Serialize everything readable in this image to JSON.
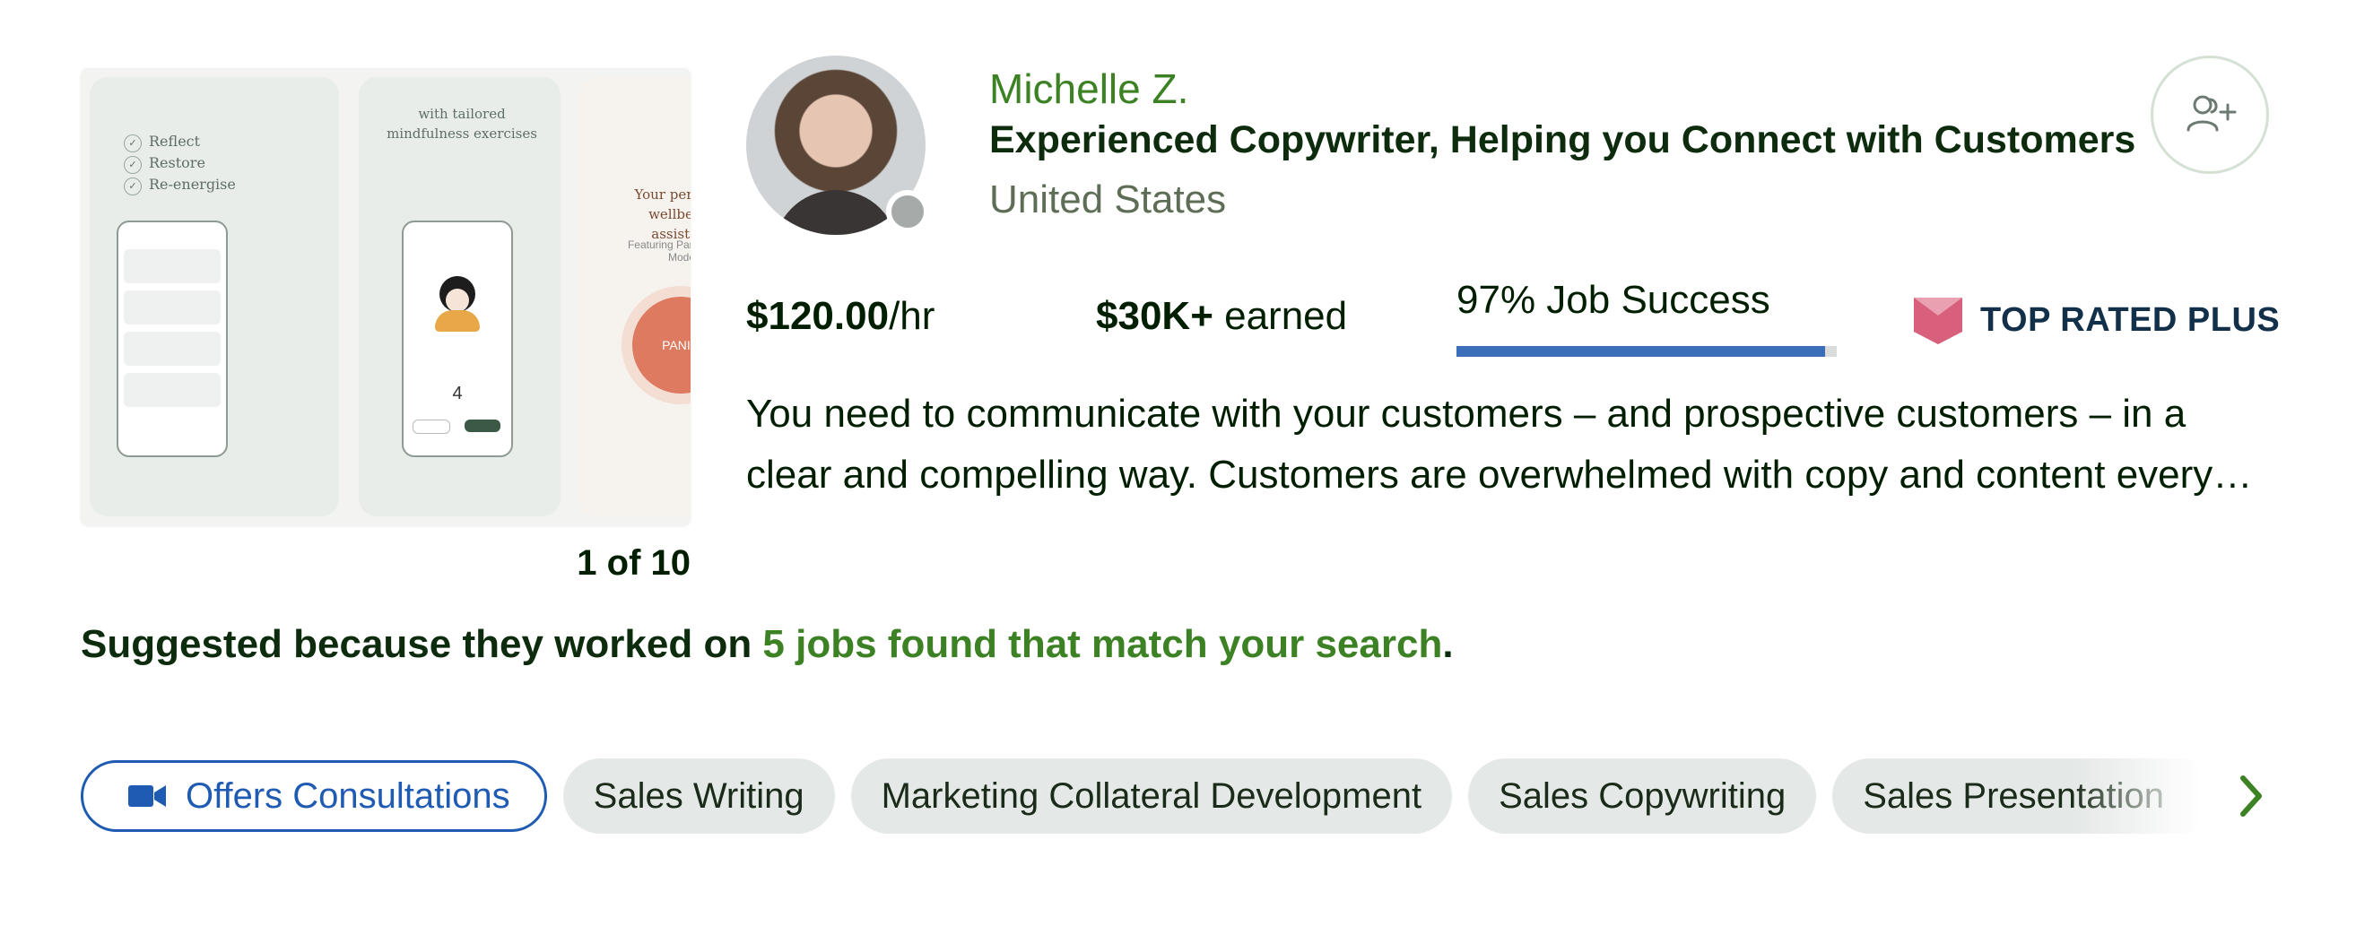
{
  "portfolio": {
    "pager": "1 of 10",
    "slide_text": {
      "reflect_items": [
        "Reflect",
        "Restore",
        "Re-energise"
      ],
      "tailored_caption": "with tailored mindfulness exercises",
      "phone_number": "4",
      "assistant_title": "Your personal wellbeing assistant",
      "assistant_sub": "Featuring Panic Attack Mode",
      "panic_label": "PANIC"
    }
  },
  "profile": {
    "name": "Michelle Z.",
    "headline": "Experienced Copywriter, Helping you Connect with Customers",
    "location": "United States",
    "status": "offline",
    "invite_icon": "add-user-icon"
  },
  "stats": {
    "rate_value": "$120.00",
    "rate_unit": "/hr",
    "earned_value": "$30K+",
    "earned_label": " earned",
    "job_success_label": "97% Job Success",
    "job_success_fraction": 0.97,
    "badge_label": "TOP RATED PLUS"
  },
  "overview": "You need to communicate with your customers – and prospective customers – in a clear and compelling way. Customers are overwhelmed with copy and content every single day, and they need a reason to pay attention.",
  "suggested": {
    "prefix": "Suggested because they worked on ",
    "link": "5 jobs found that match your search",
    "suffix": "."
  },
  "skills": {
    "consultation_label": "Offers Consultations",
    "chips": [
      "Sales Writing",
      "Marketing Collateral Development",
      "Sales Copywriting",
      "Sales Presentation"
    ]
  },
  "colors": {
    "green": "#3c8224",
    "blue": "#1f5bb3",
    "job_success_bar": "#3a6eb8",
    "badge_pink": "#d9607d"
  }
}
